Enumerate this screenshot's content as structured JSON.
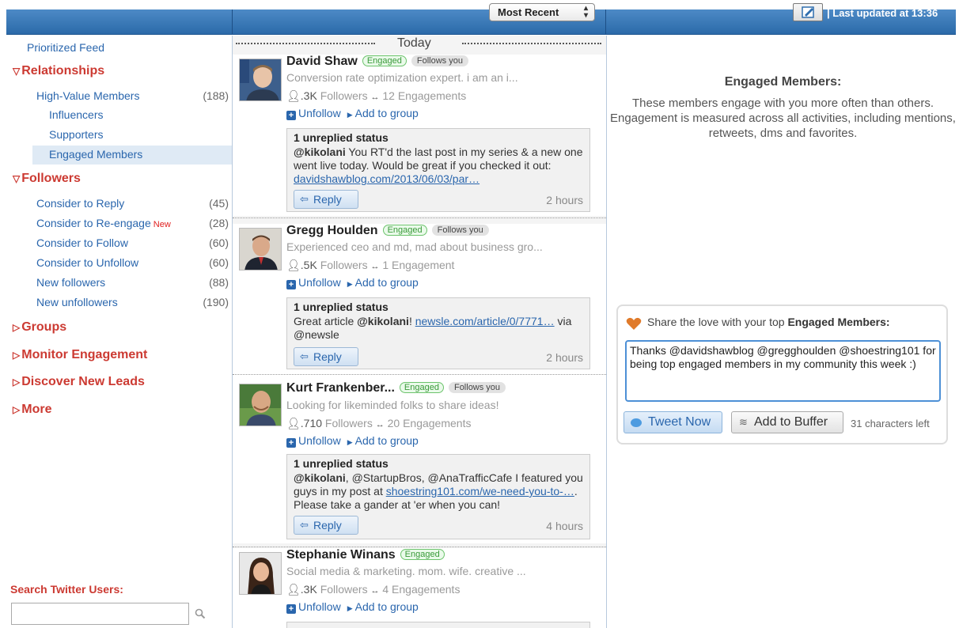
{
  "topbar": {
    "sort_value": "Most Recent",
    "last_updated": "| Last updated at 13:36"
  },
  "sidebar": {
    "prioritized_feed": "Prioritized Feed",
    "relationships": {
      "label": "Relationships",
      "items": [
        {
          "label": "High-Value Members",
          "count": "(188)"
        },
        {
          "label": "Influencers"
        },
        {
          "label": "Supporters"
        },
        {
          "label": "Engaged Members",
          "selected": true
        }
      ]
    },
    "followers": {
      "label": "Followers",
      "items": [
        {
          "label": "Consider to Reply",
          "count": "(45)"
        },
        {
          "label": "Consider to Re-engage",
          "badge": "New",
          "count": "(28)"
        },
        {
          "label": "Consider to Follow",
          "count": "(60)"
        },
        {
          "label": "Consider to Unfollow",
          "count": "(60)"
        },
        {
          "label": "New followers",
          "count": "(88)"
        },
        {
          "label": "New unfollowers",
          "count": "(190)"
        }
      ]
    },
    "groups": "Groups",
    "monitor": "Monitor Engagement",
    "discover": "Discover New Leads",
    "more": "More",
    "search_label": "Search Twitter Users:",
    "search_placeholder": ""
  },
  "feed": {
    "day_label": "Today",
    "engaged_badge": "Engaged",
    "follows_badge": "Follows you",
    "unfollow": "Unfollow",
    "add_group": "Add to group",
    "reply": "Reply",
    "unreplied": "1 unreplied status",
    "followers_word": "Followers",
    "members": [
      {
        "name": "David Shaw",
        "follows": true,
        "bio": "Conversion rate optimization expert. i am an i...",
        "followers": ".3K",
        "engagements": "12 Engagements",
        "status_parts": [
          "@kikolani",
          " You RT'd the last post in my series & a new one went live today. Would be great if you checked it out: ",
          "davidshawblog.com/2013/06/03/par…"
        ],
        "time": "2 hours"
      },
      {
        "name": "Gregg Houlden",
        "follows": true,
        "bio": "Experienced ceo and md, mad about business gro...",
        "followers": ".5K",
        "engagements": "1 Engagement",
        "status_parts": [
          "Great article ",
          "@kikolani",
          "! ",
          "newsle.com/article/0/7771…",
          " via @newsle"
        ],
        "time": "2 hours"
      },
      {
        "name": "Kurt Frankenber...",
        "follows": true,
        "bio": "Looking for likeminded folks to share ideas!",
        "followers": ".710",
        "engagements": "20 Engagements",
        "status_parts": [
          "@kikolani",
          ", @StartupBros, @AnaTrafficCafe I featured you guys in my post at ",
          "shoestring101.com/we-need-you-to-…",
          ". Please take a gander at 'er when you can!"
        ],
        "time": "4 hours"
      },
      {
        "name": "Stephanie Winans",
        "follows": false,
        "bio": "Social media & marketing. mom. wife. creative ...",
        "followers": ".3K",
        "engagements": "4 Engagements"
      }
    ]
  },
  "right": {
    "title": "Engaged Members:",
    "description": "These members engage with you more often than others. Engagement is measured across all activities, including mentions, retweets, dms and favorites.",
    "share_prefix": "Share the love with your top ",
    "share_bold": "Engaged Members:",
    "share_text": "Thanks @davidshawblog @gregghoulden @shoestring101 for being top engaged members in my community this week :)",
    "tweet_now": "Tweet Now",
    "add_buffer": "Add to Buffer",
    "chars_left": "31 characters left"
  },
  "colors": {
    "accent_blue": "#2a66ad",
    "heading_red": "#cc3a32",
    "engaged_green": "#3a9a3a",
    "topbar_blue": "#3b7ab9"
  }
}
